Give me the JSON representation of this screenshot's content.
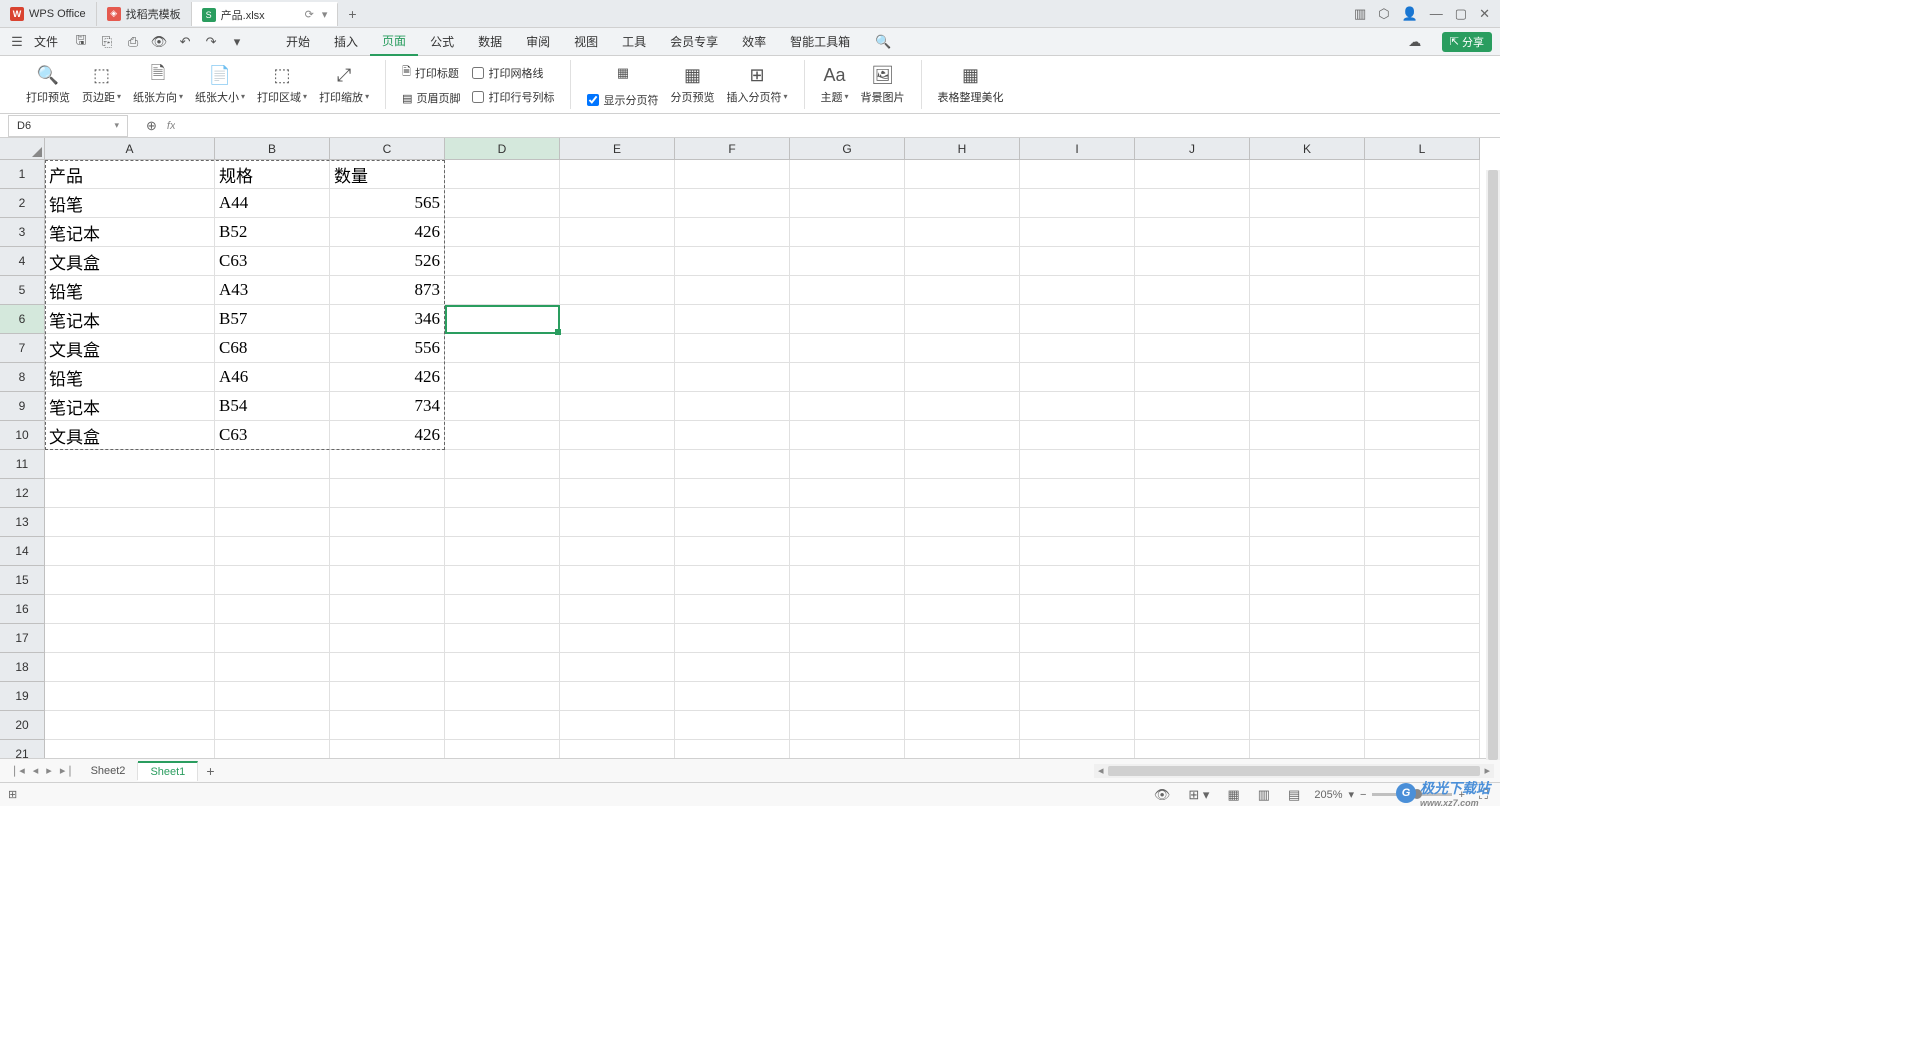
{
  "titlebar": {
    "tabs": [
      {
        "icon": "W",
        "label": "WPS Office"
      },
      {
        "icon": "◈",
        "label": "找稻壳模板"
      },
      {
        "icon": "S",
        "label": "产品.xlsx"
      }
    ],
    "window_controls": {
      "min": "—",
      "max": "▢",
      "close": "✕"
    }
  },
  "menubar": {
    "file": "文件",
    "items": [
      "开始",
      "插入",
      "页面",
      "公式",
      "数据",
      "审阅",
      "视图",
      "工具",
      "会员专享",
      "效率",
      "智能工具箱"
    ],
    "active": "页面",
    "share": "分享"
  },
  "ribbon": {
    "g1": {
      "print_preview": "打印预览",
      "page_margin": "页边距",
      "paper_orient": "纸张方向",
      "paper_size": "纸张大小",
      "print_area": "打印区域",
      "print_scale": "打印缩放"
    },
    "g2": {
      "print_title": "打印标题",
      "header_footer": "页眉页脚",
      "print_gridlines": "打印网格线",
      "print_rowcol": "打印行号列标"
    },
    "g3": {
      "show_breaks": "显示分页符",
      "page_preview": "分页预览",
      "insert_break": "插入分页符"
    },
    "g4": {
      "theme": "主题",
      "bg_image": "背景图片"
    },
    "g5": {
      "table_beautify": "表格整理美化"
    }
  },
  "namebox": {
    "value": "D6",
    "fx": "fx"
  },
  "columns": [
    "A",
    "B",
    "C",
    "D",
    "E",
    "F",
    "G",
    "H",
    "I",
    "J",
    "K",
    "L"
  ],
  "rows": [
    "1",
    "2",
    "3",
    "4",
    "5",
    "6",
    "7",
    "8",
    "9",
    "10",
    "11",
    "12",
    "13",
    "14",
    "15",
    "16",
    "17",
    "18",
    "19",
    "20",
    "21"
  ],
  "data": {
    "headers": {
      "a": "产品",
      "b": "规格",
      "c": "数量"
    },
    "r2": {
      "a": "铅笔",
      "b": "A44",
      "c": "565"
    },
    "r3": {
      "a": "笔记本",
      "b": "B52",
      "c": "426"
    },
    "r4": {
      "a": "文具盒",
      "b": "C63",
      "c": "526"
    },
    "r5": {
      "a": "铅笔",
      "b": "A43",
      "c": "873"
    },
    "r6": {
      "a": "笔记本",
      "b": "B57",
      "c": "346"
    },
    "r7": {
      "a": "文具盒",
      "b": "C68",
      "c": "556"
    },
    "r8": {
      "a": "铅笔",
      "b": "A46",
      "c": "426"
    },
    "r9": {
      "a": "笔记本",
      "b": "B54",
      "c": "734"
    },
    "r10": {
      "a": "文具盒",
      "b": "C63",
      "c": "426"
    }
  },
  "sheets": {
    "s1": "Sheet2",
    "s2": "Sheet1"
  },
  "statusbar": {
    "zoom": "205%"
  },
  "watermark": {
    "main": "极光下载站",
    "sub": "www.xz7.com"
  }
}
